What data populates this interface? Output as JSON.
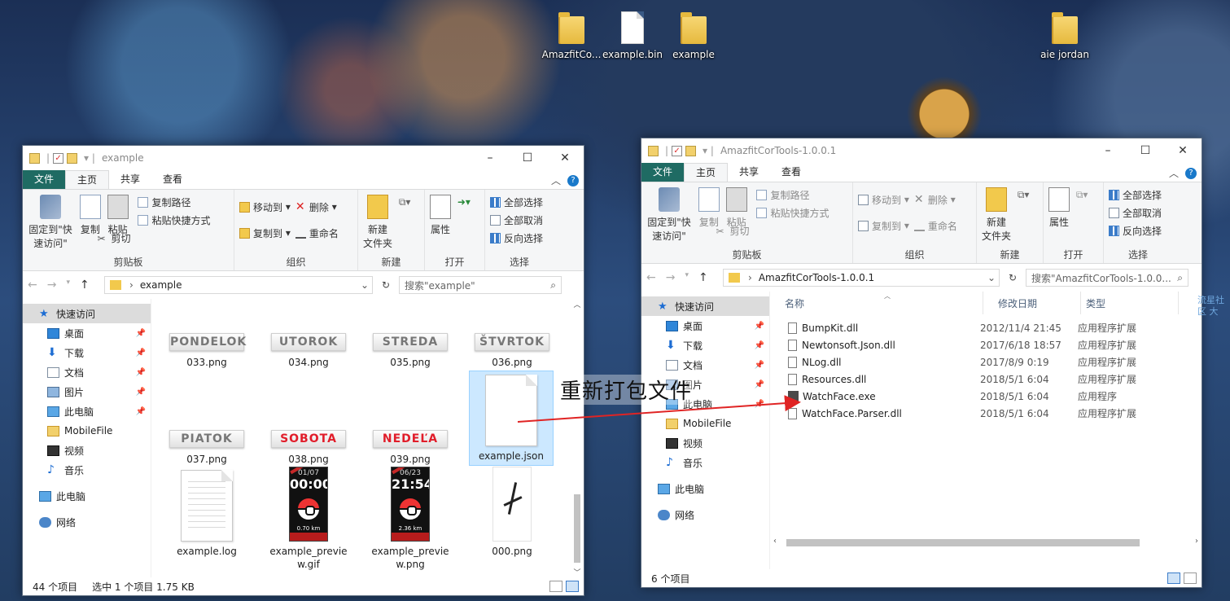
{
  "desktop": {
    "icons": [
      {
        "label": "AmazfitCo...",
        "kind": "folder-zip"
      },
      {
        "label": "example.bin",
        "kind": "file"
      },
      {
        "label": "example",
        "kind": "folder"
      },
      {
        "label": "aie jordan",
        "kind": "folder"
      }
    ],
    "annotation": "重新打包文件",
    "partial_text": "流星社区 大"
  },
  "left": {
    "title": "example",
    "tabs": [
      "文件",
      "主页",
      "共享",
      "查看"
    ],
    "ribbon": {
      "clipboard": {
        "pin": "固定到\"快速访问\"",
        "copy": "复制",
        "paste": "粘贴",
        "copy_path": "复制路径",
        "paste_shortcut": "粘贴快捷方式",
        "cut": "剪切",
        "group": "剪贴板"
      },
      "organize": {
        "move_to": "移动到",
        "delete": "删除",
        "copy_to": "复制到",
        "rename": "重命名",
        "group": "组织"
      },
      "new": {
        "new_folder": "新建\n文件夹",
        "group": "新建"
      },
      "open": {
        "properties": "属性",
        "group": "打开"
      },
      "select": {
        "select_all": "全部选择",
        "select_none": "全部取消",
        "invert": "反向选择",
        "group": "选择"
      }
    },
    "address": {
      "path": "example",
      "search_placeholder": "搜索\"example\""
    },
    "nav": [
      {
        "label": "快速访问",
        "icon": "star-icon"
      },
      {
        "label": "桌面",
        "icon": "desktop-icon",
        "pinned": true
      },
      {
        "label": "下载",
        "icon": "download-icon",
        "pinned": true
      },
      {
        "label": "文档",
        "icon": "documents-icon",
        "pinned": true
      },
      {
        "label": "图片",
        "icon": "pictures-icon",
        "pinned": true
      },
      {
        "label": "此电脑",
        "icon": "computer-icon",
        "pinned": true
      },
      {
        "label": "MobileFile",
        "icon": "folder-icon"
      },
      {
        "label": "视频",
        "icon": "video-icon"
      },
      {
        "label": "音乐",
        "icon": "music-icon"
      },
      {
        "label": "此电脑",
        "icon": "computer-icon"
      },
      {
        "label": "网络",
        "icon": "network-icon"
      }
    ],
    "files": [
      {
        "name": "033.png",
        "day": "PONDELOK",
        "red": false
      },
      {
        "name": "034.png",
        "day": "UTOROK",
        "red": false
      },
      {
        "name": "035.png",
        "day": "STREDA",
        "red": false
      },
      {
        "name": "036.png",
        "day": "ŠTVRTOK",
        "red": false
      },
      {
        "name": "037.png",
        "day": "PIATOK",
        "red": false
      },
      {
        "name": "038.png",
        "day": "SOBOTA",
        "red": true
      },
      {
        "name": "039.png",
        "day": "NEDEĽA",
        "red": true
      },
      {
        "name": "example.json"
      },
      {
        "name": "example.log"
      },
      {
        "name": "example_previe\nw.gif",
        "date": "01/07",
        "time": "00:00",
        "dist": "0.70 km"
      },
      {
        "name": "example_previe\nw.png",
        "date": "06/23",
        "time": "21:54",
        "dist": "2.36 km"
      },
      {
        "name": "000.png"
      }
    ],
    "status": {
      "count": "44 个项目",
      "selected": "选中 1 个项目  1.75 KB"
    }
  },
  "right": {
    "title": "AmazfitCorTools-1.0.0.1",
    "tabs": [
      "文件",
      "主页",
      "共享",
      "查看"
    ],
    "ribbon": {
      "clipboard": {
        "pin": "固定到\"快速访问\"",
        "copy": "复制",
        "paste": "粘贴",
        "copy_path": "复制路径",
        "paste_shortcut": "粘贴快捷方式",
        "cut": "剪切",
        "group": "剪贴板"
      },
      "organize": {
        "move_to": "移动到",
        "delete": "删除",
        "copy_to": "复制到",
        "rename": "重命名",
        "group": "组织"
      },
      "new": {
        "new_folder": "新建\n文件夹",
        "group": "新建"
      },
      "open": {
        "properties": "属性",
        "group": "打开"
      },
      "select": {
        "select_all": "全部选择",
        "select_none": "全部取消",
        "invert": "反向选择",
        "group": "选择"
      }
    },
    "address": {
      "path": "AmazfitCorTools-1.0.0.1",
      "search_placeholder": "搜索\"AmazfitCorTools-1.0.0..."
    },
    "nav": [
      {
        "label": "快速访问",
        "icon": "star-icon"
      },
      {
        "label": "桌面",
        "icon": "desktop-icon",
        "pinned": true
      },
      {
        "label": "下载",
        "icon": "download-icon",
        "pinned": true
      },
      {
        "label": "文档",
        "icon": "documents-icon",
        "pinned": true
      },
      {
        "label": "图片",
        "icon": "pictures-icon",
        "pinned": true
      },
      {
        "label": "此电脑",
        "icon": "computer-icon",
        "pinned": true
      },
      {
        "label": "MobileFile",
        "icon": "folder-icon"
      },
      {
        "label": "视频",
        "icon": "video-icon"
      },
      {
        "label": "音乐",
        "icon": "music-icon"
      },
      {
        "label": "此电脑",
        "icon": "computer-icon"
      },
      {
        "label": "网络",
        "icon": "network-icon"
      }
    ],
    "columns": [
      "名称",
      "修改日期",
      "类型"
    ],
    "rows": [
      {
        "name": "BumpKit.dll",
        "date": "2012/11/4 21:45",
        "type": "应用程序扩展",
        "icon": "dll"
      },
      {
        "name": "Newtonsoft.Json.dll",
        "date": "2017/6/18 18:57",
        "type": "应用程序扩展",
        "icon": "dll"
      },
      {
        "name": "NLog.dll",
        "date": "2017/8/9 0:19",
        "type": "应用程序扩展",
        "icon": "dll"
      },
      {
        "name": "Resources.dll",
        "date": "2018/5/1 6:04",
        "type": "应用程序扩展",
        "icon": "dll"
      },
      {
        "name": "WatchFace.exe",
        "date": "2018/5/1 6:04",
        "type": "应用程序",
        "icon": "exe"
      },
      {
        "name": "WatchFace.Parser.dll",
        "date": "2018/5/1 6:04",
        "type": "应用程序扩展",
        "icon": "dll"
      }
    ],
    "status": {
      "count": "6 个项目"
    }
  },
  "colors": {
    "file_tab": "#1f6b63",
    "selection": "#cce8ff",
    "arrow": "#e02424"
  }
}
